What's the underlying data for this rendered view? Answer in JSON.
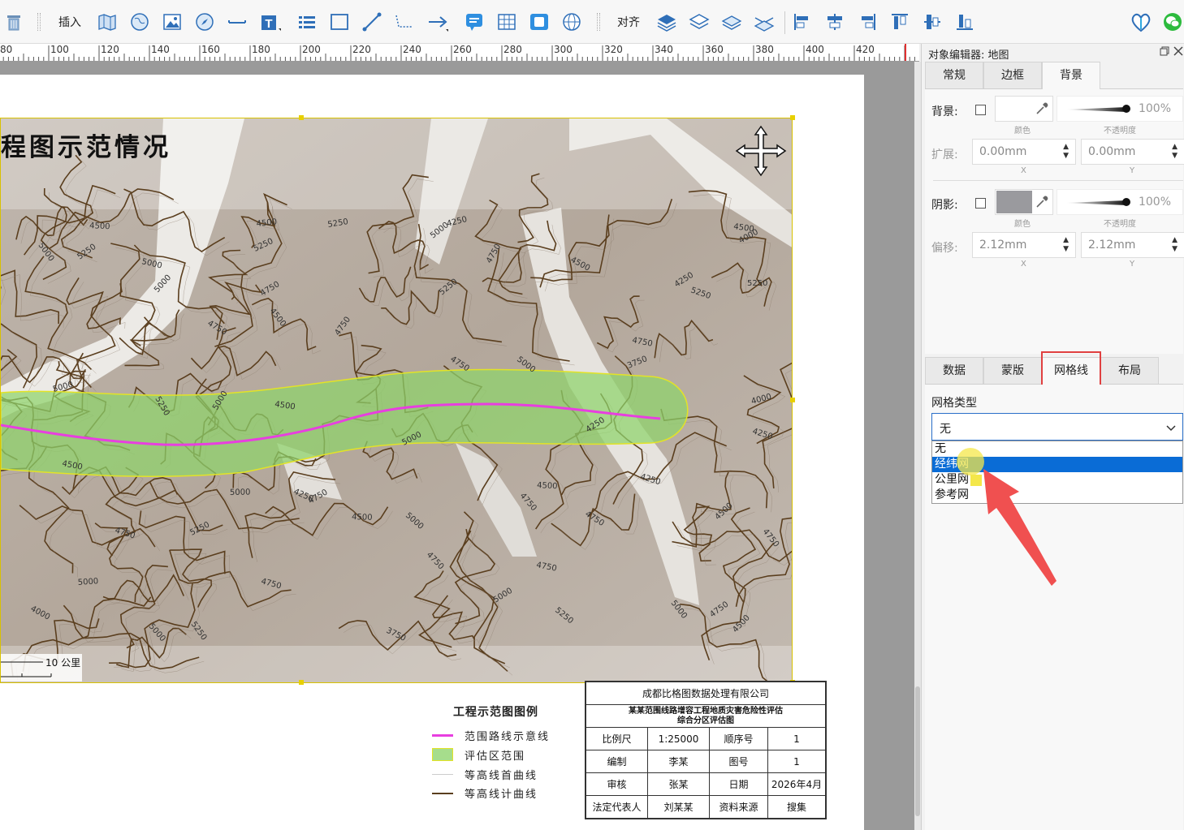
{
  "toolbar": {
    "insert_label": "插入",
    "align_label": "对齐"
  },
  "ruler": {
    "ticks": [
      "80",
      "100",
      "120",
      "140",
      "160",
      "180",
      "200",
      "220",
      "240",
      "260",
      "280",
      "300",
      "320",
      "340",
      "360",
      "380",
      "400",
      "420"
    ]
  },
  "map": {
    "title": "程图示范情况",
    "scale_text": "10 公里",
    "contour_labels": [
      "4500",
      "4750",
      "4000",
      "3750",
      "4250",
      "4000",
      "4250",
      "4750",
      "3750",
      "4500",
      "5000",
      "4250",
      "4500",
      "5000",
      "5250",
      "5250",
      "4750",
      "5000",
      "4750",
      "4500",
      "5250",
      "5250",
      "5000",
      "5250",
      "4250",
      "5000",
      "4250",
      "4000",
      "4500",
      "5250",
      "5000",
      "5250",
      "4750",
      "5000",
      "4750",
      "4500",
      "5000",
      "4250",
      "4750",
      "4500",
      "4750",
      "5000",
      "5250",
      "5000",
      "5250",
      "4750",
      "4750",
      "4500",
      "5000",
      "4750",
      "4500",
      "5000",
      "5250",
      "4500",
      "4750",
      "4750",
      "5000",
      "5000",
      "4750",
      "4500",
      "4750"
    ]
  },
  "legend": {
    "title": "工程示范图图例",
    "items": [
      {
        "label": "范围路线示意线",
        "color": "#e83ee0"
      },
      {
        "label": "评估区范围",
        "color": "#a6dd8c"
      },
      {
        "label": "等高线首曲线",
        "color": "#cccccc"
      },
      {
        "label": "等高线计曲线",
        "color": "#5a3e1e"
      }
    ]
  },
  "title_block": {
    "company": "成都比格图数据处理有限公司",
    "subject_line1": "某某范围线路增容工程地质灾害危险性评估",
    "subject_line2": "综合分区评估图",
    "rows": [
      [
        "比例尺",
        "1:25000",
        "顺序号",
        "1"
      ],
      [
        "编制",
        "李某",
        "图号",
        "1"
      ],
      [
        "审核",
        "张某",
        "日期",
        "2026年4月"
      ],
      [
        "法定代表人",
        "刘某某",
        "资料来源",
        "搜集"
      ]
    ]
  },
  "panel": {
    "title": "对象编辑器: 地图",
    "top_tabs": [
      "常规",
      "边框",
      "背景"
    ],
    "active_top_tab": "背景",
    "background": {
      "bg_label": "背景:",
      "bg_opacity": "100%",
      "color_sub": "颜色",
      "opacity_sub": "不透明度",
      "extend_label": "扩展:",
      "extend_x": "0.00mm",
      "extend_y": "0.00mm",
      "x_sub": "X",
      "y_sub": "Y",
      "shadow_label": "阴影:",
      "shadow_color": "#9a9a9e",
      "shadow_opacity": "100%",
      "offset_label": "偏移:",
      "offset_x": "2.12mm",
      "offset_y": "2.12mm"
    },
    "bottom_tabs": [
      "数据",
      "蒙版",
      "网格线",
      "布局"
    ],
    "active_bottom_tab": "网格线",
    "grid_type_label": "网格类型",
    "grid_type_value": "无",
    "grid_options": [
      "无",
      "经纬网",
      "公里网",
      "参考网"
    ],
    "highlighted_option": "经纬网"
  },
  "colors": {
    "route": "#e83ee0",
    "zone_fill": "#8fd46b",
    "zone_border": "#e3e326",
    "contour": "#5a3e1e",
    "selection_handle": "#e8d000",
    "tab_highlight": "#e04040",
    "annotation_arrow": "#f05050"
  }
}
